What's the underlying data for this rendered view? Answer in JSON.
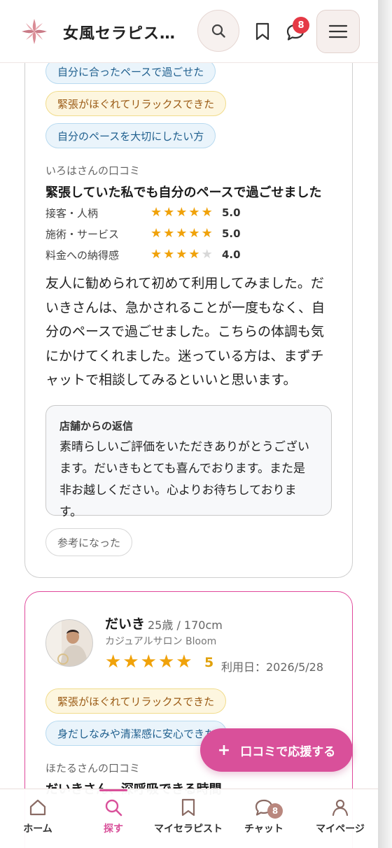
{
  "header": {
    "brand": "女風セラピス…",
    "chat_badge": "8"
  },
  "review1": {
    "tags": [
      "自分に合ったペースで過ごせた",
      "緊張がほぐれてリラックスできた",
      "自分のペースを大切にしたい方"
    ],
    "reviewer": "いろはさんの口コミ",
    "title": "緊張していた私でも自分のペースで過ごせました",
    "ratings": [
      {
        "label": "接客・人柄",
        "value": "5.0",
        "stars": 5
      },
      {
        "label": "施術・サービス",
        "value": "5.0",
        "stars": 5
      },
      {
        "label": "料金への納得感",
        "value": "4.0",
        "stars": 4
      }
    ],
    "body": "友人に勧められて初めて利用してみました。だいきさんは、急かされることが一度もなく、自分のペースで過ごせました。こちらの体調も気にかけてくれました。迷っている方は、まずチャットで相談してみるといいと思います。",
    "reply_title": "店舗からの返信",
    "reply_text": "素晴らしいご評価をいただきありがとうございます。だいきもとても喜んでおります。また是非お越しください。心よりお待ちしております。",
    "helpful_label": "参考になった"
  },
  "review2": {
    "therapist_name": "だいき",
    "therapist_meta": "25歳 / 170cm",
    "shop": "カジュアルサロン Bloom",
    "score": "5",
    "use_date": "利用日：2026/5/28",
    "tags": [
      "緊張がほぐれてリラックスできた",
      "身だしなみや清潔感に安心できた"
    ],
    "reviewer": "ほたるさんの口コミ",
    "title": "だいきさん、深呼吸できる時間"
  },
  "fab": {
    "label": "口コミで応援する",
    "plus": "+"
  },
  "bottom_nav": {
    "items": [
      {
        "label": "ホーム",
        "icon": "home-icon"
      },
      {
        "label": "探す",
        "icon": "search-icon"
      },
      {
        "label": "マイセラピスト",
        "icon": "bookmark-icon"
      },
      {
        "label": "チャット",
        "icon": "chat-icon"
      },
      {
        "label": "マイページ",
        "icon": "person-icon"
      }
    ],
    "chat_badge": "8"
  },
  "colors": {
    "accent": "#d9509a",
    "star": "#f0a20a",
    "badge": "#e53945"
  }
}
